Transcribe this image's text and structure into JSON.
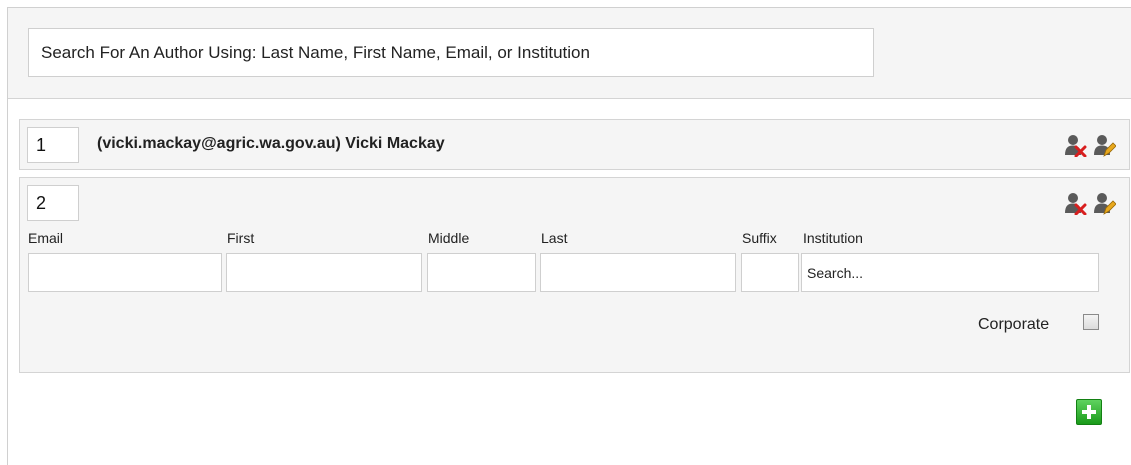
{
  "search": {
    "placeholder": "Search For An Author Using: Last Name, First Name, Email, or Institution"
  },
  "authors": [
    {
      "order": "1",
      "display": "(vicki.mackay@agric.wa.gov.au) Vicki Mackay",
      "icons": [
        "remove-author-icon",
        "edit-author-icon"
      ]
    },
    {
      "order": "2",
      "icons": [
        "remove-author-icon",
        "edit-author-icon"
      ],
      "labels": {
        "email": "Email",
        "first": "First",
        "middle": "Middle",
        "last": "Last",
        "suffix": "Suffix",
        "institution": "Institution"
      },
      "values": {
        "email": "",
        "first": "",
        "middle": "",
        "last": "",
        "suffix": ""
      },
      "institution_placeholder": "Search...",
      "corporate_label": "Corporate",
      "corporate_checked": false
    }
  ],
  "add_icon": "add-author-icon",
  "colors": {
    "panel": "#f5f5f5",
    "border": "#d4d4d4",
    "add_green": "#22a722",
    "remove_red": "#d81e1e",
    "edit_yellow": "#e8a81c"
  }
}
